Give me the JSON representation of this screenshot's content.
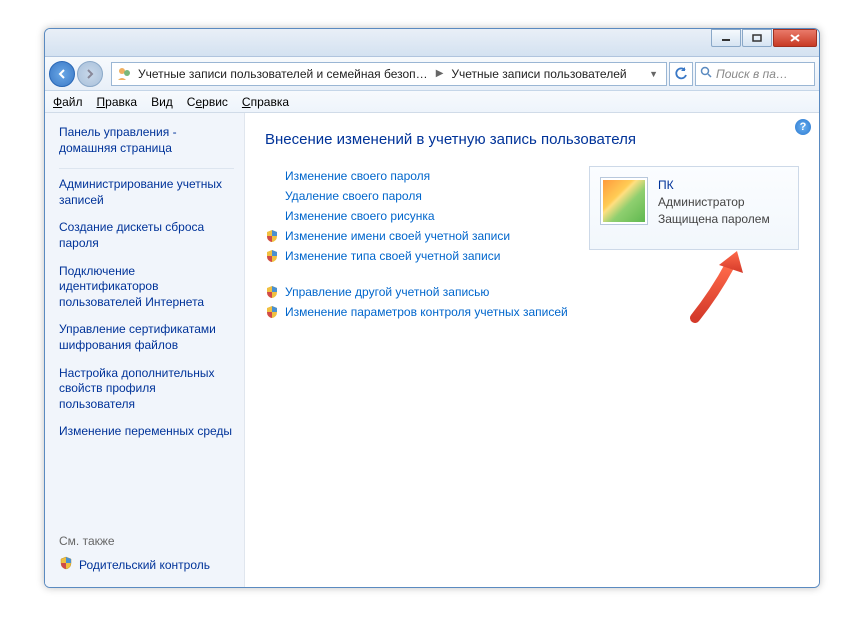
{
  "breadcrumb": {
    "seg1": "Учетные записи пользователей и семейная безоп…",
    "seg2": "Учетные записи пользователей"
  },
  "search": {
    "placeholder": "Поиск в па…"
  },
  "menu": {
    "file": "Файл",
    "edit": "Правка",
    "view": "Вид",
    "tools": "Сервис",
    "help": "Справка"
  },
  "sidebar": {
    "home": "Панель управления - домашняя страница",
    "links": [
      "Администрирование учетных записей",
      "Создание дискеты сброса пароля",
      "Подключение идентификаторов пользователей Интернета",
      "Управление сертификатами шифрования файлов",
      "Настройка дополнительных свойств профиля пользователя",
      "Изменение переменных среды"
    ],
    "seealso_label": "См. также",
    "seealso_item": "Родительский контроль"
  },
  "main": {
    "heading": "Внесение изменений в учетную запись пользователя",
    "tasks_noicon": [
      "Изменение своего пароля",
      "Удаление своего пароля",
      "Изменение своего рисунка"
    ],
    "tasks_shield1": [
      "Изменение имени своей учетной записи",
      "Изменение типа своей учетной записи"
    ],
    "tasks_shield2": [
      "Управление другой учетной записью",
      "Изменение параметров контроля учетных записей"
    ],
    "user": {
      "name": "ПК",
      "role": "Администратор",
      "status": "Защищена паролем"
    }
  }
}
